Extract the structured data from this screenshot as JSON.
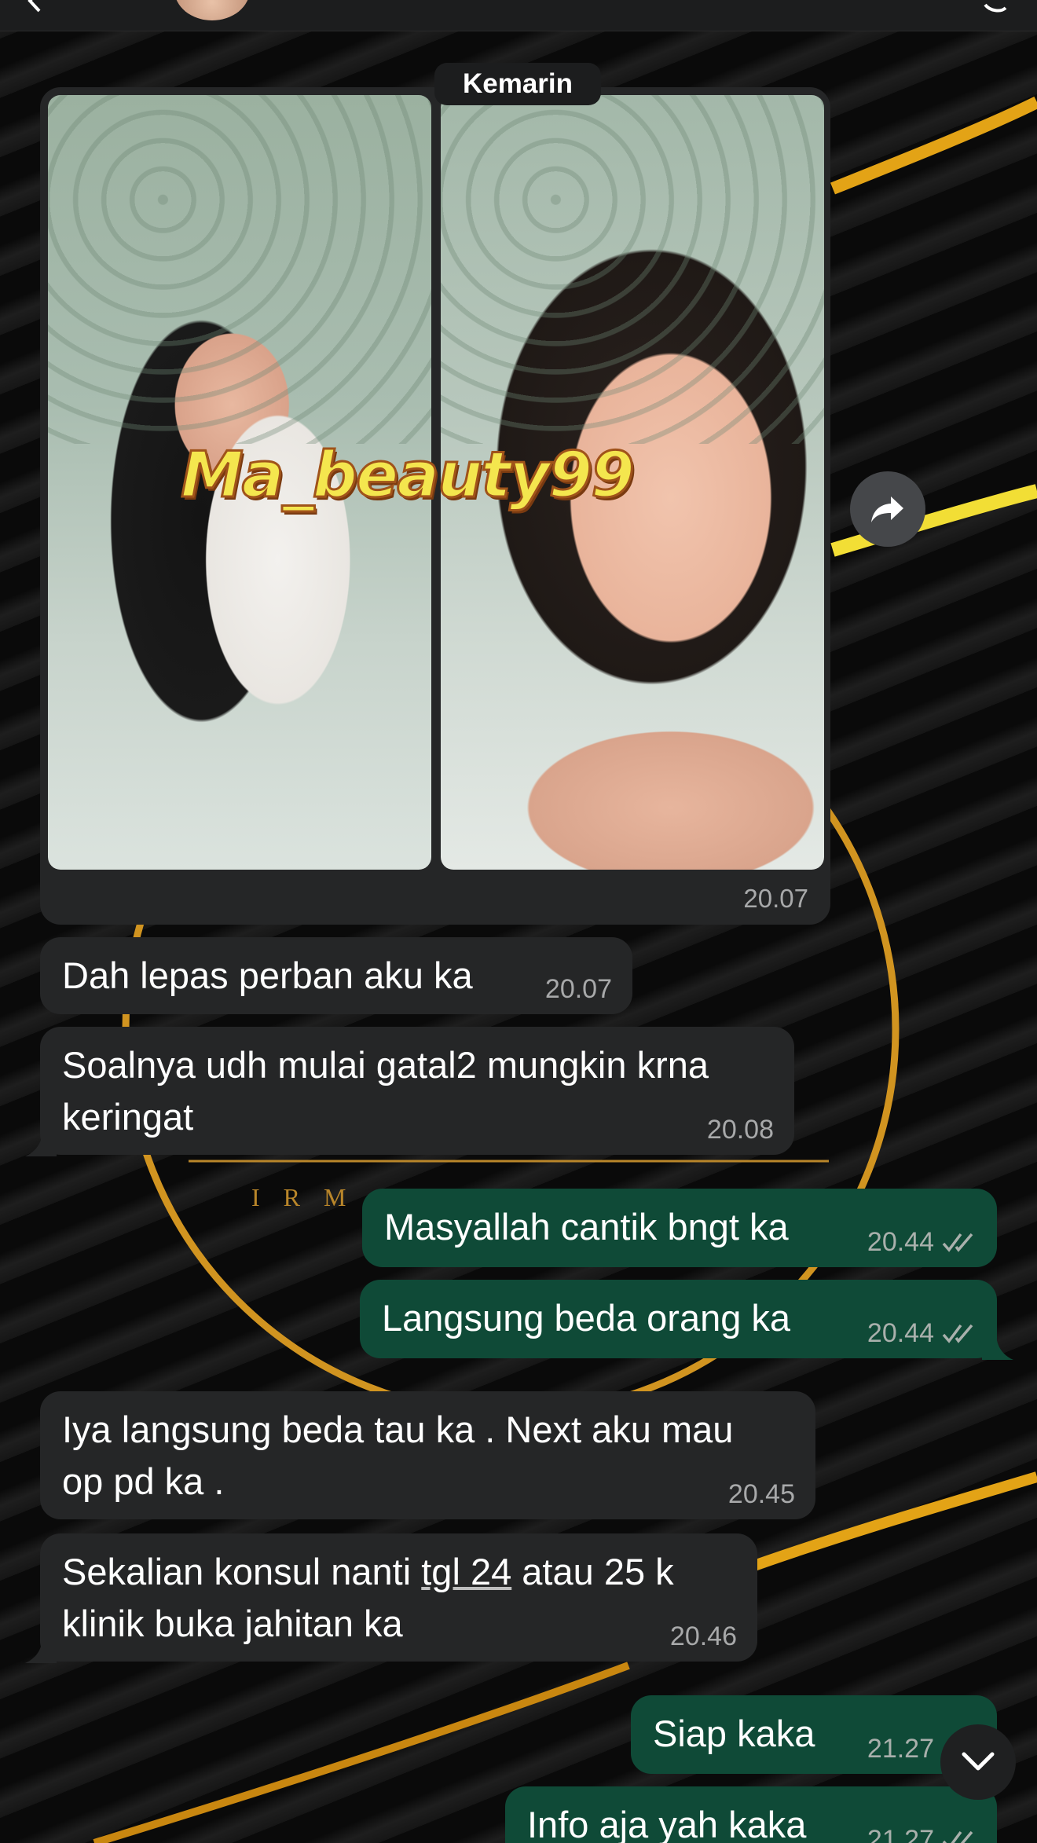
{
  "date_chip": "Kemarin",
  "album": {
    "watermark": "Ma_beauty99",
    "time": "20.07"
  },
  "messages": [
    {
      "direction": "in",
      "text": "Dah lepas perban aku ka",
      "time": "20.07"
    },
    {
      "direction": "in",
      "text_line1": "Soalnya udh mulai gatal2 mungkin krna",
      "text_line2": "keringat",
      "time": "20.08"
    },
    {
      "direction": "out",
      "text": "Masyallah cantik bngt ka",
      "time": "20.44",
      "status": "read"
    },
    {
      "direction": "out",
      "text": "Langsung beda orang ka",
      "time": "20.44",
      "status": "read"
    },
    {
      "direction": "in",
      "text_line1": "Iya langsung beda tau ka . Next aku mau",
      "text_line2": "op pd ka .",
      "time": "20.45"
    },
    {
      "direction": "in",
      "text_line1a": "Sekalian konsul nanti ",
      "text_link": "tgl 24",
      "text_line1b": " atau 25 k",
      "text_line2": "klinik buka jahitan ka",
      "time": "20.46"
    },
    {
      "direction": "out",
      "text": "Siap kaka",
      "time": "21.27",
      "status": "read"
    },
    {
      "direction": "out",
      "text": "Info aja yah kaka",
      "time": "21.27",
      "status": "read"
    }
  ],
  "colors": {
    "incoming_bubble": "#252627",
    "outgoing_bubble": "#0f4a37",
    "background": "#050505",
    "accent_gold": "#e3a316"
  },
  "icons": {
    "back": "chevron-left-icon",
    "forward": "forward-arrow-icon",
    "read_receipt": "double-check-icon",
    "scroll_down": "chevron-down-icon",
    "call": "phone-icon"
  }
}
